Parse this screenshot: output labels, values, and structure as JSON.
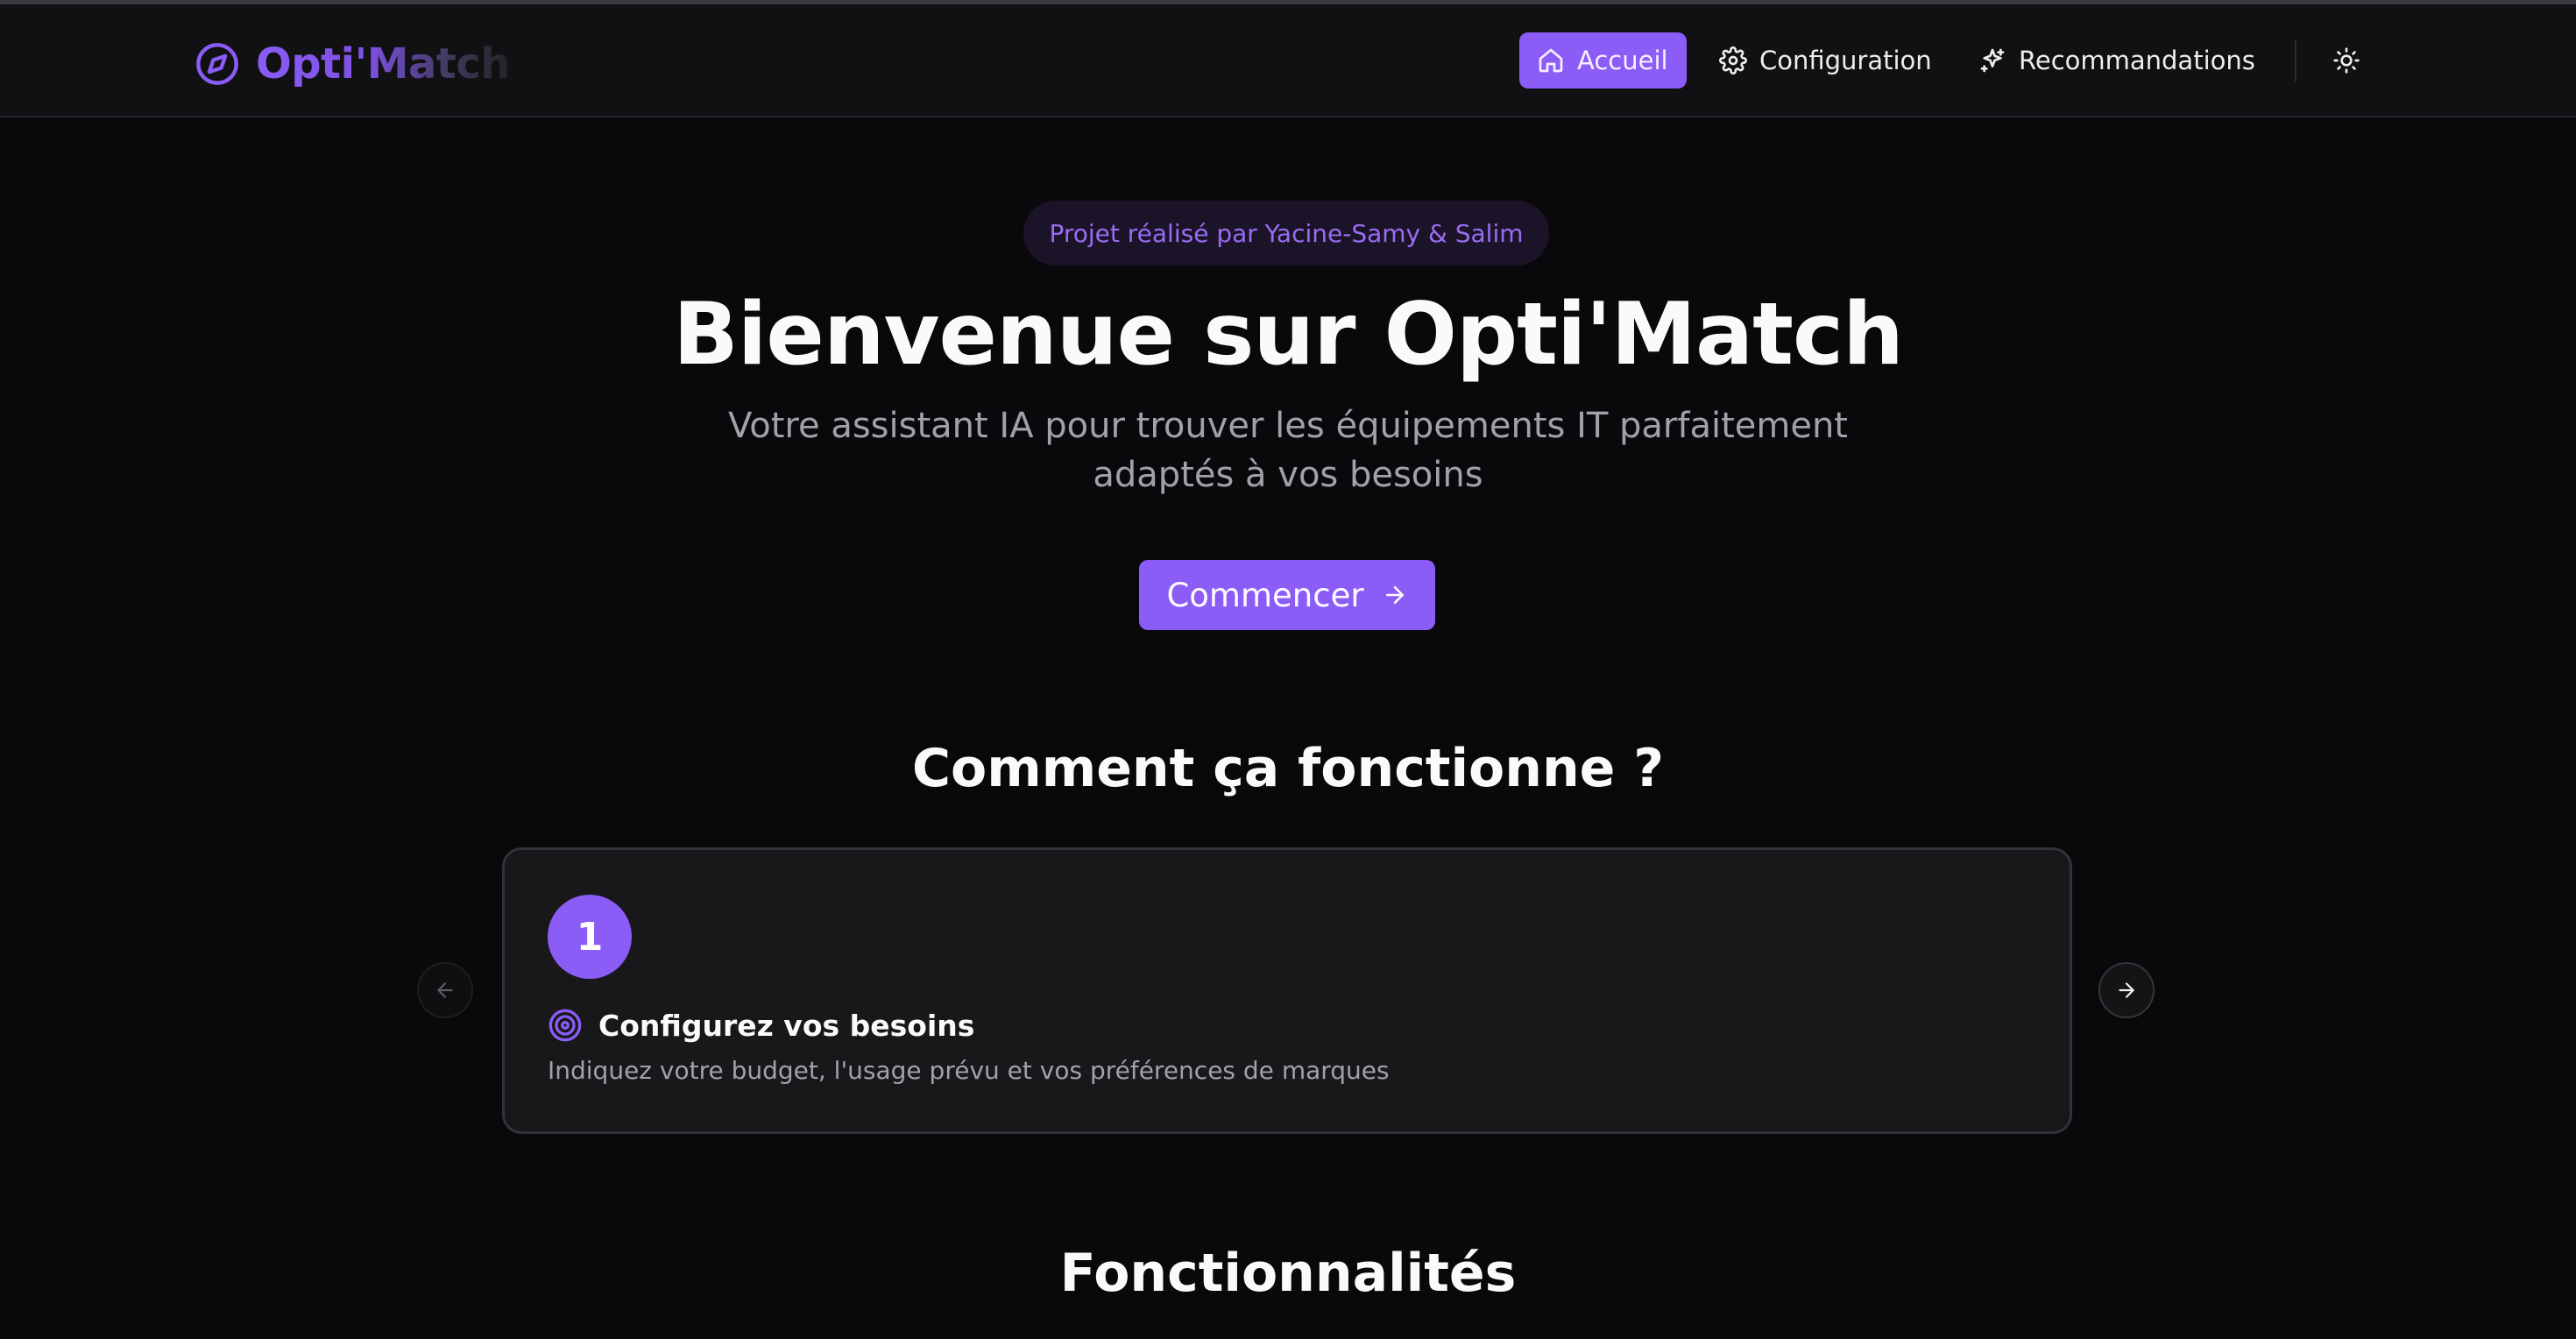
{
  "brand": {
    "name": "Opti'Match",
    "icon": "compass-icon"
  },
  "nav": {
    "items": [
      {
        "label": "Accueil",
        "icon": "home-icon",
        "active": true
      },
      {
        "label": "Configuration",
        "icon": "gear-icon",
        "active": false
      },
      {
        "label": "Recommandations",
        "icon": "sparkles-icon",
        "active": false
      }
    ],
    "theme_toggle_icon": "sun-icon"
  },
  "hero": {
    "badge": "Projet réalisé par Yacine-Samy & Salim",
    "title": "Bienvenue sur Opti'Match",
    "subtitle": "Votre assistant IA pour trouver les équipements IT parfaitement adaptés à vos besoins",
    "cta_label": "Commencer"
  },
  "how_it_works": {
    "title": "Comment ça fonctionne ?",
    "current_step": {
      "number": "1",
      "title": "Configurez vos besoins",
      "description": "Indiquez votre budget, l'usage prévu et vos préférences de marques",
      "icon": "target-icon"
    }
  },
  "features": {
    "title": "Fonctionnalités"
  },
  "colors": {
    "accent": "#8b5cf6",
    "background": "#09090b",
    "card": "#18181b",
    "muted_text": "#a1a1aa"
  }
}
